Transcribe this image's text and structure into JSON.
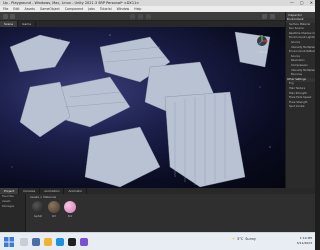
{
  "window": {
    "title": "Up - Playground - Windows, Mac, Linux - Unity 2021.3 SRP Personal* <DX11>",
    "controls": [
      "—",
      "▢",
      "✕"
    ]
  },
  "menu": [
    "File",
    "Edit",
    "Assets",
    "GameObject",
    "Component",
    "Jobs",
    "Tutorial",
    "Window",
    "Help"
  ],
  "scene_tabs": [
    "Scene",
    "Game"
  ],
  "scene": {
    "persp_label": "< Persp"
  },
  "inspector": {
    "title": "Inspector",
    "rows": [
      {
        "text": "Environment",
        "kind": "section"
      },
      {
        "text": "Surface Material",
        "kind": "row"
      },
      {
        "text": "Sun Source",
        "kind": "row"
      },
      {
        "text": "Realtime Shadow Color",
        "kind": "row"
      },
      {
        "text": "Environment Lighting",
        "kind": "row"
      },
      {
        "text": "Source",
        "kind": "sub"
      },
      {
        "text": "Intensity Multiplier",
        "kind": "sub"
      },
      {
        "text": "Environment Reflections",
        "kind": "row"
      },
      {
        "text": "Source",
        "kind": "sub"
      },
      {
        "text": "Resolution",
        "kind": "sub"
      },
      {
        "text": "Compression",
        "kind": "sub"
      },
      {
        "text": "Intensity Multiplier",
        "kind": "sub"
      },
      {
        "text": "Bounces",
        "kind": "sub"
      },
      {
        "text": "Other Settings",
        "kind": "section"
      },
      {
        "text": "Fog",
        "kind": "row"
      },
      {
        "text": "Halo Texture",
        "kind": "row"
      },
      {
        "text": "Halo Strength",
        "kind": "row"
      },
      {
        "text": "Flare Fade Speed",
        "kind": "row"
      },
      {
        "text": "Flare Strength",
        "kind": "row"
      },
      {
        "text": "Spot Cookie",
        "kind": "row"
      }
    ]
  },
  "bottom_tabs": [
    "Project",
    "Console",
    "Animation",
    "Animator"
  ],
  "project": {
    "sidebar": [
      "Favorites",
      "Assets",
      "Packages"
    ],
    "breadcrumb": "Assets > Materials",
    "assets": [
      {
        "label": "Asphalt",
        "color": "#2c2c2c"
      },
      {
        "label": "Dirt",
        "color": "#5a4a3a"
      },
      {
        "label": "Pink",
        "color": "#e08fc0"
      }
    ]
  },
  "taskbar": {
    "weather_temp": "3°C",
    "weather_text": "Sunny",
    "time": "1:19 PM",
    "date": "3/11/2023"
  },
  "colors": {
    "accent": "#3a7bd5",
    "space": "#1c1f4a",
    "meshes": "#b8c2d3"
  }
}
